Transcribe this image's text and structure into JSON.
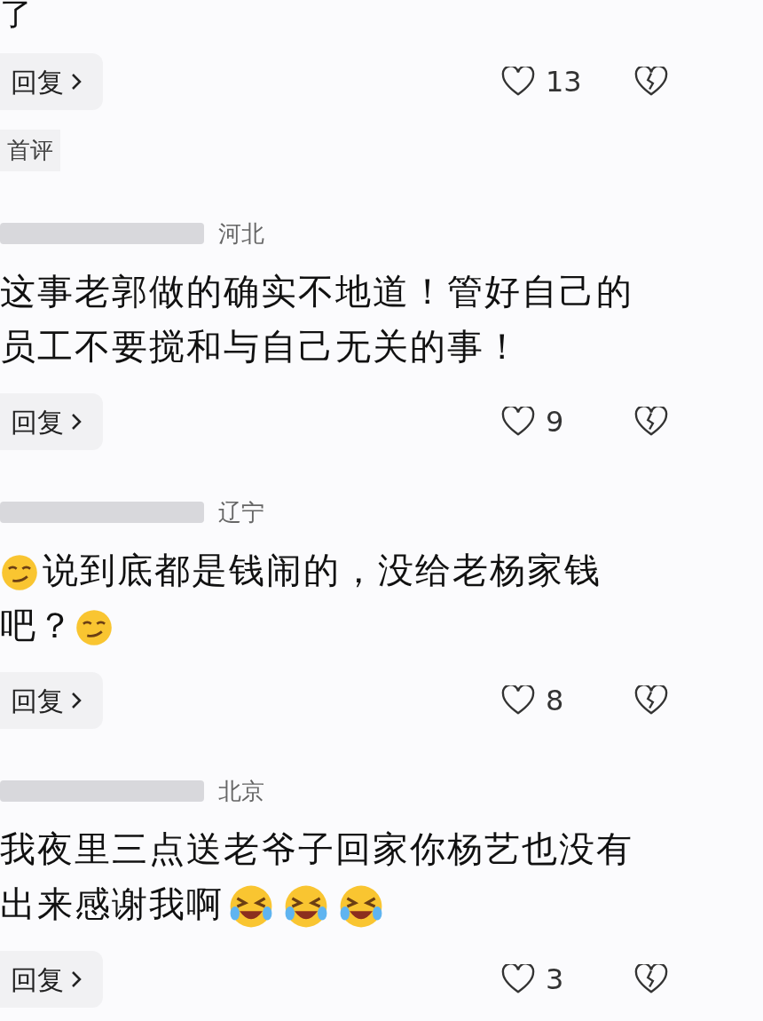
{
  "first_comment": {
    "text": "了",
    "reply": "回复",
    "likes": "13",
    "badge": "首评"
  },
  "comments": [
    {
      "location": "河北",
      "content": [
        {
          "kind": "text",
          "text": "这事老郭做的确实不地道！管好自己的员工不要搅和与自己无关的事！"
        }
      ],
      "reply": "回复",
      "likes": "9"
    },
    {
      "location": "辽宁",
      "content": [
        {
          "kind": "smirk"
        },
        {
          "kind": "text",
          "text": "说到底都是钱闹的，没给老杨家钱吧？"
        },
        {
          "kind": "smirk"
        }
      ],
      "reply": "回复",
      "likes": "8"
    },
    {
      "location": "北京",
      "content": [
        {
          "kind": "text",
          "text": "我夜里三点送老爷子回家你杨艺也没有出来感谢我啊"
        },
        {
          "kind": "laugh"
        },
        {
          "kind": "laugh"
        },
        {
          "kind": "laugh"
        }
      ],
      "reply": "回复",
      "likes": "3"
    }
  ]
}
